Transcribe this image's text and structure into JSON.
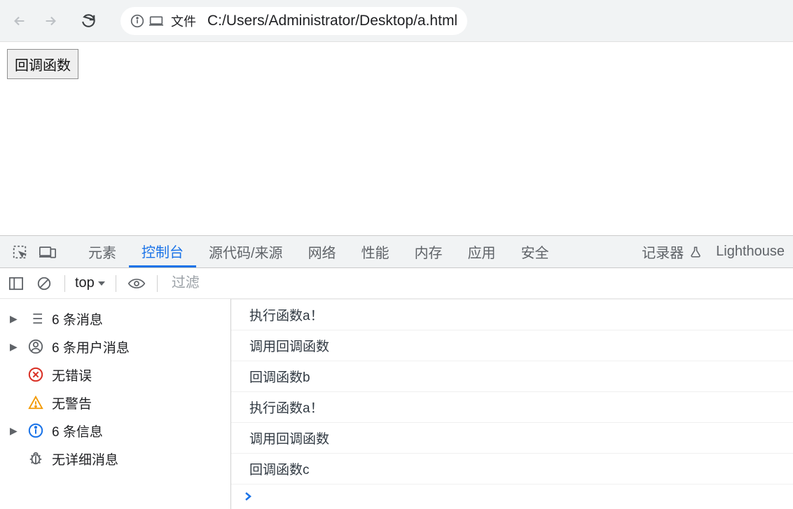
{
  "browser": {
    "file_label": "文件",
    "url": "C:/Users/Administrator/Desktop/a.html"
  },
  "page": {
    "button_label": "回调函数"
  },
  "devtools": {
    "tabs": {
      "elements": "元素",
      "console": "控制台",
      "sources": "源代码/来源",
      "network": "网络",
      "performance": "性能",
      "memory": "内存",
      "application": "应用",
      "security": "安全",
      "recorder": "记录器",
      "lighthouse": "Lighthouse"
    }
  },
  "console": {
    "context": "top",
    "filter_placeholder": "过滤",
    "sidebar": {
      "messages": "6 条消息",
      "user_messages": "6 条用户消息",
      "no_errors": "无错误",
      "no_warnings": "无警告",
      "info": "6 条信息",
      "no_verbose": "无详细消息"
    },
    "logs": [
      "执行函数a！",
      "调用回调函数",
      "回调函数b",
      "执行函数a！",
      "调用回调函数",
      "回调函数c"
    ]
  }
}
